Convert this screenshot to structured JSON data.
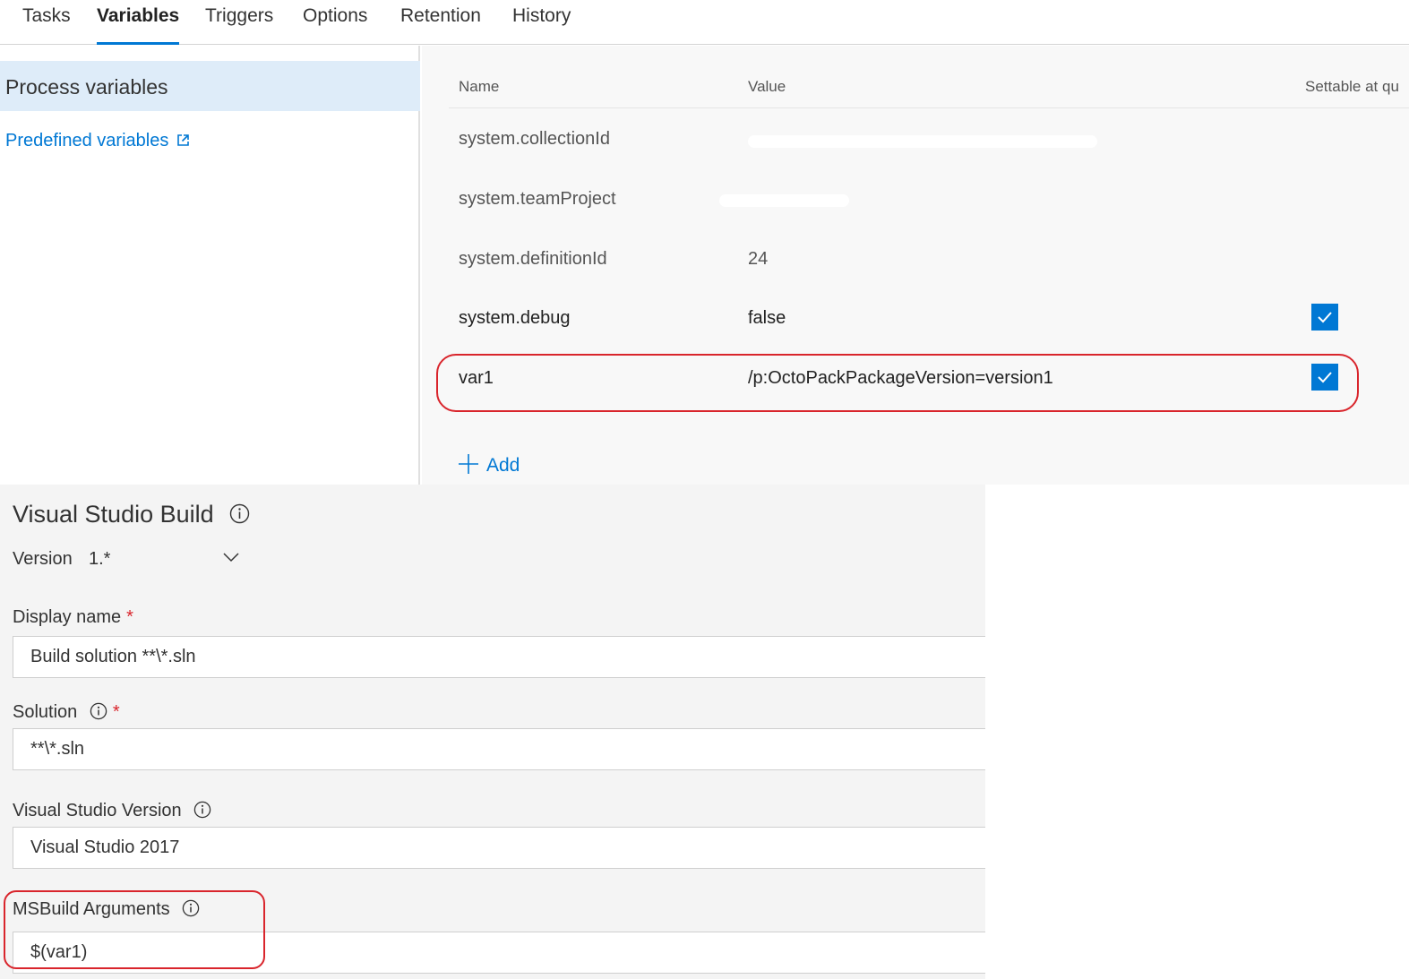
{
  "tabs": [
    {
      "label": "Tasks",
      "active": false
    },
    {
      "label": "Variables",
      "active": true
    },
    {
      "label": "Triggers",
      "active": false
    },
    {
      "label": "Options",
      "active": false
    },
    {
      "label": "Retention",
      "active": false
    },
    {
      "label": "History",
      "active": false
    }
  ],
  "sidebar": {
    "selected_label": "Process variables",
    "link_label": "Predefined variables"
  },
  "grid": {
    "columns": {
      "name": "Name",
      "value": "Value",
      "settable": "Settable at qu"
    },
    "rows": [
      {
        "name": "system.collectionId",
        "value": "",
        "settable": false,
        "redacted": true
      },
      {
        "name": "system.teamProject",
        "value": "",
        "settable": false,
        "redacted": true
      },
      {
        "name": "system.definitionId",
        "value": "24",
        "settable": false
      },
      {
        "name": "system.debug",
        "value": "false",
        "settable": true
      },
      {
        "name": "var1",
        "value": "/p:OctoPackPackageVersion=version1",
        "settable": true,
        "highlighted": true
      }
    ],
    "add_label": "Add"
  },
  "task": {
    "title": "Visual Studio Build",
    "version_label": "Version",
    "version_value": "1.*",
    "fields": {
      "display_name": {
        "label": "Display name",
        "required": "*",
        "value": "Build solution **\\*.sln"
      },
      "solution": {
        "label": "Solution",
        "required": "*",
        "value": "**\\*.sln"
      },
      "vs_version": {
        "label": "Visual Studio Version",
        "value": "Visual Studio 2017"
      },
      "msbuild_args": {
        "label": "MSBuild Arguments",
        "value": "$(var1)",
        "highlighted": true
      }
    }
  },
  "colors": {
    "accent": "#0078d4",
    "selected_bg": "#deecf9",
    "highlight_outline": "#d9252c"
  }
}
